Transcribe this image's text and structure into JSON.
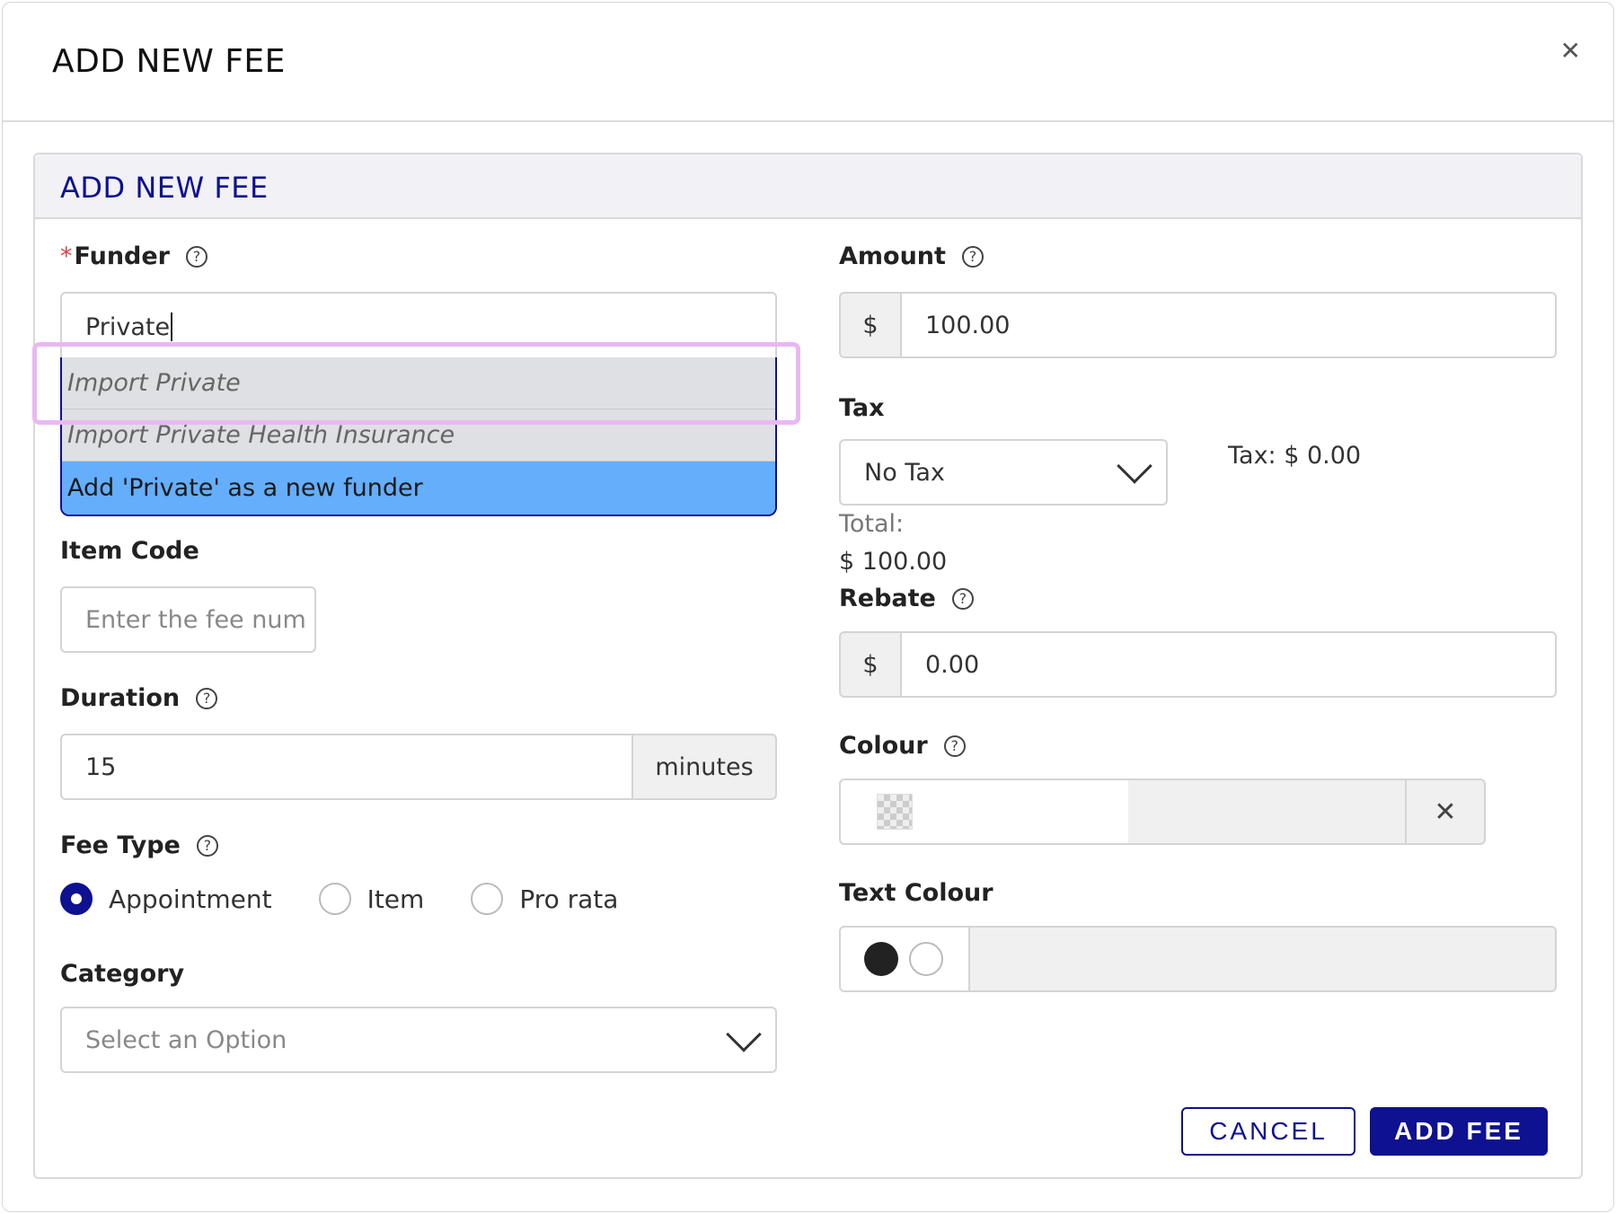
{
  "modal": {
    "title": "ADD NEW FEE"
  },
  "panel": {
    "title": "ADD NEW FEE"
  },
  "funder": {
    "label": "Funder",
    "required_mark": "*",
    "value": "Private",
    "options": [
      "Import Private",
      "Import Private Health Insurance",
      "Add 'Private' as a new funder"
    ]
  },
  "item_code": {
    "label": "Item Code",
    "placeholder": "Enter the fee num"
  },
  "duration": {
    "label": "Duration",
    "value": "15",
    "unit": "minutes"
  },
  "fee_type": {
    "label": "Fee Type",
    "options": [
      "Appointment",
      "Item",
      "Pro rata"
    ],
    "selected": "Appointment"
  },
  "category": {
    "label": "Category",
    "placeholder": "Select an Option"
  },
  "amount": {
    "label": "Amount",
    "currency": "$",
    "value": "100.00"
  },
  "tax": {
    "label": "Tax",
    "selected": "No Tax",
    "tax_display": "Tax: $ 0.00"
  },
  "total": {
    "label": "Total:",
    "value": "$ 100.00"
  },
  "rebate": {
    "label": "Rebate",
    "currency": "$",
    "value": "0.00"
  },
  "colour": {
    "label": "Colour"
  },
  "text_colour": {
    "label": "Text Colour"
  },
  "buttons": {
    "cancel": "CANCEL",
    "add": "ADD FEE"
  },
  "colors": {
    "primary": "#0e1190",
    "dropdown_active": "#64aefc",
    "highlight": "#e9b8f2"
  }
}
